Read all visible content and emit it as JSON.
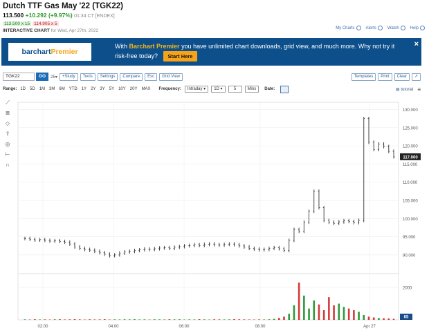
{
  "header": {
    "title": "Dutch TTF Gas May '22 (TGK22)",
    "last": "113.500",
    "change": "+10.292 (+9.97%)",
    "time": "01:34 CT [ENDEX]",
    "bid": "113.500 x 15",
    "ask": "114.905 x 5",
    "chart_title": "INTERACTIVE CHART",
    "chart_date": "for Wed, Apr 27th, 2022"
  },
  "toplinks": [
    "My Charts",
    "Alerts",
    "Watch",
    "Help"
  ],
  "banner": {
    "logo_a": "barchart",
    "logo_b": "Premier",
    "msg_a": "With",
    "msg_hl": "Barchart Premier",
    "msg_b": "you have unlimited chart downloads, grid view, and much more. Why not try it risk-free today?",
    "cta": "Start Here",
    "close": "×"
  },
  "toolbar": {
    "symbol": "TGK22",
    "go": "GO",
    "interval": "25",
    "buttons": [
      "+Study",
      "Tools",
      "Settings",
      "Compare",
      "Esc",
      "Grid View"
    ],
    "right_buttons": [
      "Templates",
      "Print",
      "Clear"
    ]
  },
  "rangebar": {
    "range_label": "Range:",
    "ranges": [
      "1D",
      "5D",
      "1M",
      "3M",
      "6M",
      "YTD",
      "1Y",
      "2Y",
      "3Y",
      "5Y",
      "10Y",
      "20Y",
      "MAX"
    ],
    "freq_label": "Frequency:",
    "frequency": "Intraday",
    "period": "1D",
    "count": "5",
    "unit": "Mins",
    "date_label": "Date:",
    "tutorial": "tutorial"
  },
  "chart_data": {
    "type": "ohlc",
    "x_ticks": [
      "02:00",
      "04:00",
      "06:00",
      "08:00",
      "Apr 27"
    ],
    "y_ticks": [
      90.0,
      95.0,
      100.0,
      105.0,
      110.0,
      115.0,
      120.0,
      125.0,
      130.0
    ],
    "ylim": [
      86,
      132
    ],
    "last_price_label": "117.000",
    "volume_ticks": [
      2000
    ],
    "volume_last_label": "65",
    "price_series": [
      94.5,
      94.3,
      94.1,
      94.2,
      94.0,
      93.8,
      93.9,
      93.7,
      93.5,
      93.0,
      92.2,
      91.8,
      91.5,
      91.3,
      91.0,
      90.6,
      90.2,
      89.8,
      90.0,
      90.5,
      90.8,
      91.0,
      91.2,
      91.4,
      91.6,
      91.5,
      91.7,
      91.9,
      92.0,
      91.8,
      92.1,
      92.3,
      92.5,
      92.6,
      92.8,
      92.6,
      92.9,
      93.0,
      92.8,
      92.7,
      92.9,
      93.0,
      92.8,
      92.5,
      92.2,
      91.8,
      91.6,
      91.4,
      91.5,
      91.8,
      92.0,
      91.7,
      91.2,
      94.0,
      97.0,
      96.5,
      99.0,
      102.0,
      107.5,
      103.0,
      99.5,
      99.0,
      98.7,
      99.1,
      99.4,
      99.2,
      98.9,
      99.5,
      127.5,
      121.0,
      119.0,
      120.5,
      119.8,
      118.5,
      117.0
    ],
    "volume_series": [
      30,
      20,
      40,
      25,
      30,
      20,
      35,
      40,
      25,
      30,
      45,
      30,
      20,
      35,
      25,
      30,
      40,
      20,
      30,
      25,
      35,
      30,
      40,
      25,
      30,
      20,
      35,
      30,
      25,
      40,
      30,
      35,
      20,
      30,
      25,
      40,
      30,
      20,
      35,
      30,
      25,
      30,
      45,
      35,
      30,
      25,
      20,
      30,
      25,
      35,
      60,
      120,
      200,
      380,
      900,
      2300,
      1500,
      700,
      1200,
      950,
      600,
      1400,
      900,
      1000,
      800,
      700,
      600,
      500,
      300,
      200,
      150,
      120,
      100,
      90,
      65
    ]
  }
}
